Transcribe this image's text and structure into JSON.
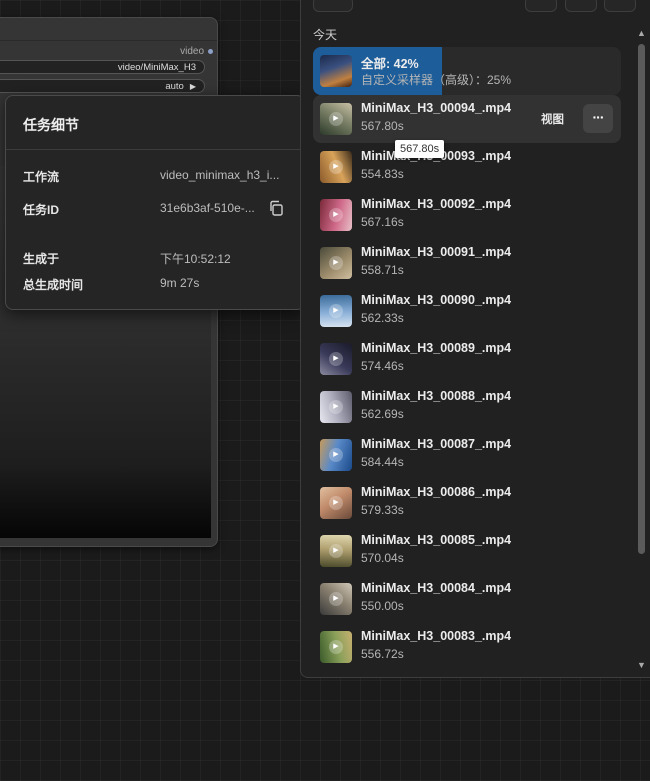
{
  "node": {
    "output_label": "video",
    "widget1_value": "video/MiniMax_H3",
    "widget2_value": "auto",
    "controls": [
      "volume-icon",
      "fullscreen-icon",
      "more-vertical-icon"
    ]
  },
  "detail": {
    "title": "任务细节",
    "rows": [
      {
        "key": "工作流",
        "value": "video_minimax_h3_i..."
      },
      {
        "key": "任务ID",
        "value": "31e6b3af-510e-..."
      },
      {
        "key": "生成于",
        "value": "下午10:52:12"
      },
      {
        "key": "总生成时间",
        "value": "9m 27s"
      }
    ]
  },
  "queue": {
    "section_title": "今天",
    "progress_item": {
      "title": "全部: 42%",
      "subtitle": "自定义采样器（高级）：25%",
      "overall_progress_percent": 42,
      "node_progress_percent": 25
    },
    "view_label": "视图",
    "more_label": "···",
    "tooltip": "567.80s",
    "items": [
      {
        "name": "MiniMax_H3_00094_.mp4",
        "duration": "567.80s",
        "colors": [
          "#2c3a2a",
          "#7a8066",
          "#c9c1a6"
        ]
      },
      {
        "name": "MiniMax_H3_00093_.mp4",
        "duration": "554.83s",
        "colors": [
          "#8a5a2b",
          "#d9a35a",
          "#3a2a1a"
        ]
      },
      {
        "name": "MiniMax_H3_00092_.mp4",
        "duration": "567.16s",
        "colors": [
          "#7a2a3a",
          "#d06a8a",
          "#e8c0c8"
        ]
      },
      {
        "name": "MiniMax_H3_00091_.mp4",
        "duration": "558.71s",
        "colors": [
          "#4a4a3a",
          "#9a8a6a",
          "#d0c0a0"
        ]
      },
      {
        "name": "MiniMax_H3_00090_.mp4",
        "duration": "562.33s",
        "colors": [
          "#3a6a9a",
          "#8ab0d8",
          "#d8e4f0"
        ]
      },
      {
        "name": "MiniMax_H3_00089_.mp4",
        "duration": "574.46s",
        "colors": [
          "#1a1a2a",
          "#3a3a5a",
          "#8a8aa0"
        ]
      },
      {
        "name": "MiniMax_H3_00088_.mp4",
        "duration": "562.69s",
        "colors": [
          "#5a5a6a",
          "#b0b0c0",
          "#e8e8f0"
        ]
      },
      {
        "name": "MiniMax_H3_00087_.mp4",
        "duration": "584.44s",
        "colors": [
          "#1a4a8a",
          "#5a8ac8",
          "#c89a5a"
        ]
      },
      {
        "name": "MiniMax_H3_00086_.mp4",
        "duration": "579.33s",
        "colors": [
          "#6a4a3a",
          "#c08a6a",
          "#e0c0a0"
        ]
      },
      {
        "name": "MiniMax_H3_00085_.mp4",
        "duration": "570.04s",
        "colors": [
          "#4a4a2a",
          "#b0a070",
          "#e0d8b0"
        ]
      },
      {
        "name": "MiniMax_H3_00084_.mp4",
        "duration": "550.00s",
        "colors": [
          "#3a3a3a",
          "#8a8070",
          "#d0c8b8"
        ]
      },
      {
        "name": "MiniMax_H3_00083_.mp4",
        "duration": "556.72s",
        "colors": [
          "#3a5a2a",
          "#8aa05a",
          "#c8b070"
        ]
      }
    ]
  }
}
